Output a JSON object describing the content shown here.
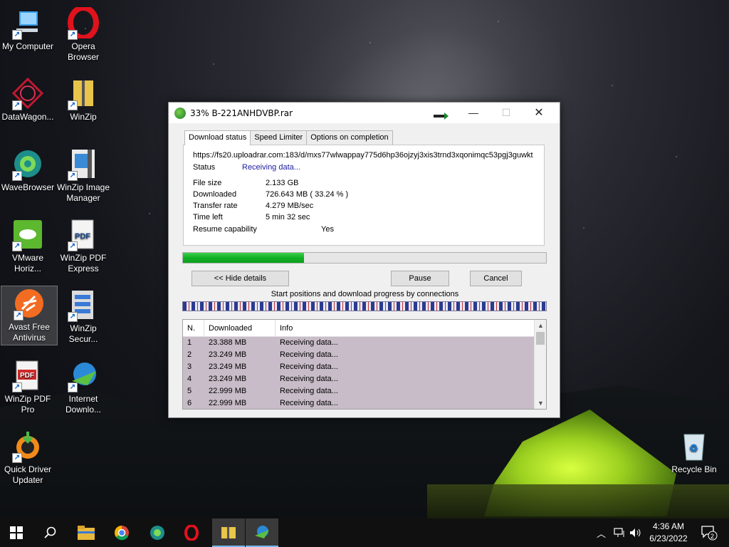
{
  "desktop": {
    "icons": [
      {
        "label": "My Computer",
        "icon": "computer-icon"
      },
      {
        "label": "Opera Browser",
        "icon": "opera-icon"
      },
      {
        "label": "DataWagon...",
        "icon": "datawagon-icon"
      },
      {
        "label": "WinZip",
        "icon": "winzip-icon"
      },
      {
        "label": "WaveBrowser",
        "icon": "wavebrowser-icon"
      },
      {
        "label": "WinZip Image Manager",
        "icon": "winzip-image-icon"
      },
      {
        "label": "VMware Horiz...",
        "icon": "vmware-icon"
      },
      {
        "label": "WinZip PDF Express",
        "icon": "pdf-icon"
      },
      {
        "label": "Avast Free Antivirus",
        "icon": "avast-icon"
      },
      {
        "label": "WinZip Secur...",
        "icon": "winzip-secure-icon"
      },
      {
        "label": "WinZip PDF Pro",
        "icon": "pdf-pro-icon"
      },
      {
        "label": "Internet Downlo...",
        "icon": "idm-icon"
      },
      {
        "label": "Quick Driver Updater",
        "icon": "driver-updater-icon"
      },
      {
        "label": "Recycle Bin",
        "icon": "recycle-bin-icon"
      }
    ]
  },
  "window": {
    "title": "33% B-221ANHDVBP.rar",
    "tabs": [
      "Download status",
      "Speed Limiter",
      "Options on completion"
    ],
    "url": "https://fs20.uploadrar.com:183/d/mxs77wlwappay775d6hp36ojzyj3xis3trnd3xqonimqc53pgj3guwkt",
    "status_label": "Status",
    "status_value": "Receiving data...",
    "file_size_label": "File size",
    "file_size_value": "2.133  GB",
    "downloaded_label": "Downloaded",
    "downloaded_value": "726.643  MB  ( 33.24 % )",
    "transfer_rate_label": "Transfer rate",
    "transfer_rate_value": "4.279  MB/sec",
    "time_left_label": "Time left",
    "time_left_value": "5 min 32 sec",
    "resume_label": "Resume capability",
    "resume_value": "Yes",
    "progress_fraction": 0.3324,
    "hide_details_label": "<< Hide details",
    "pause_label": "Pause",
    "cancel_label": "Cancel",
    "connections_caption": "Start positions and download progress by connections",
    "table": {
      "headers": [
        "N.",
        "Downloaded",
        "Info"
      ],
      "rows": [
        {
          "n": "1",
          "downloaded": "23.388  MB",
          "info": "Receiving data..."
        },
        {
          "n": "2",
          "downloaded": "23.249  MB",
          "info": "Receiving data..."
        },
        {
          "n": "3",
          "downloaded": "23.249  MB",
          "info": "Receiving data..."
        },
        {
          "n": "4",
          "downloaded": "23.249  MB",
          "info": "Receiving data..."
        },
        {
          "n": "5",
          "downloaded": "22.999  MB",
          "info": "Receiving data..."
        },
        {
          "n": "6",
          "downloaded": "22.999  MB",
          "info": "Receiving data..."
        }
      ]
    }
  },
  "taskbar": {
    "time": "4:36 AM",
    "date": "6/23/2022",
    "notification_count": "2"
  },
  "colors": {
    "progress": "#12b024",
    "status_text": "#1a1aa0",
    "row_highlight": "#c8bcc8"
  }
}
